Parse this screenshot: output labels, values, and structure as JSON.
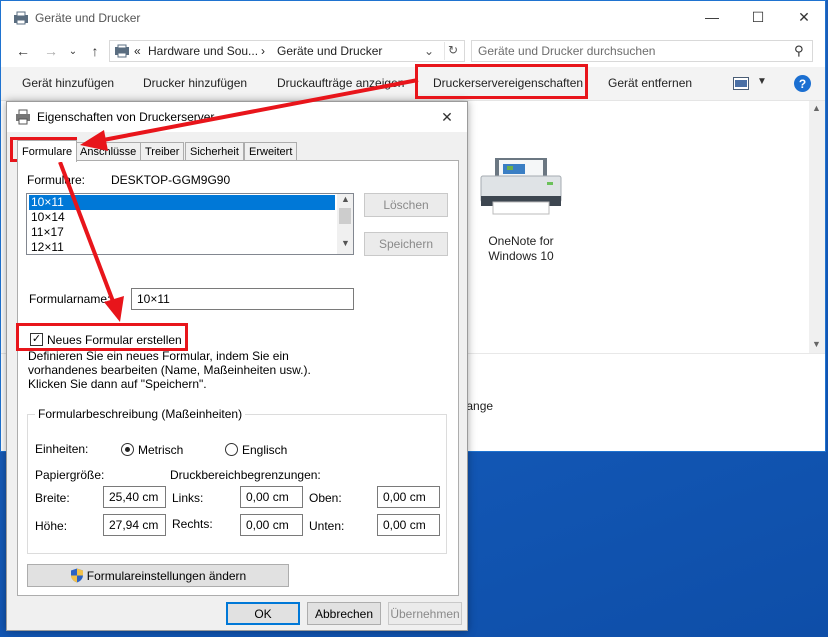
{
  "explorer": {
    "title": "Geräte und Drucker",
    "address": [
      "«",
      "Hardware und Sou...",
      "›",
      "Geräte und Drucker"
    ],
    "search_placeholder": "Geräte und Drucker durchsuchen",
    "commands": [
      "Gerät hinzufügen",
      "Drucker hinzufügen",
      "Druckaufträge anzeigen",
      "Druckerservereigenschaften",
      "Gerät entfernen"
    ],
    "help": "?",
    "device": [
      "OneNote for",
      "Windows 10"
    ],
    "status_fragment": "hlange"
  },
  "dialog": {
    "title": "Eigenschaften von Druckerserver",
    "tabs": [
      "Formulare",
      "Anschlüsse",
      "Treiber",
      "Sicherheit",
      "Erweitert"
    ],
    "forms_label": "Formulare:",
    "server_name": "DESKTOP-GGM9G90",
    "forms_list": [
      "10×11",
      "10×14",
      "11×17",
      "12×11"
    ],
    "delete_button": "Löschen",
    "save_button": "Speichern",
    "form_name_label": "Formularname:",
    "form_name_value": "10×11",
    "new_form_checkbox": "Neues Formular erstellen",
    "new_form_checked": true,
    "description": [
      "Definieren Sie ein neues Formular, indem Sie ein",
      "vorhandenes bearbeiten (Name, Maßeinheiten usw.).",
      "Klicken Sie dann auf \"Speichern\"."
    ],
    "group_title": "Formularbeschreibung (Maßeinheiten)",
    "units_label": "Einheiten:",
    "unit_metric": "Metrisch",
    "unit_english": "Englisch",
    "unit_selected": "Metrisch",
    "paper_size_label": "Papiergröße:",
    "margins_label": "Druckbereichbegrenzungen:",
    "width_label": "Breite:",
    "height_label": "Höhe:",
    "width_value": "25,40 cm",
    "height_value": "27,94 cm",
    "left_label": "Links:",
    "right_label": "Rechts:",
    "top_label": "Oben:",
    "bottom_label": "Unten:",
    "left_value": "0,00 cm",
    "right_value": "0,00 cm",
    "top_value": "0,00 cm",
    "bottom_value": "0,00 cm",
    "change_settings_button": "Formulareinstellungen ändern",
    "ok": "OK",
    "cancel": "Abbrechen",
    "apply": "Übernehmen"
  },
  "colors": {
    "annotation_red": "#e8151b",
    "selection_blue": "#0078d7",
    "desktop_blue": "#1e5fb8"
  }
}
